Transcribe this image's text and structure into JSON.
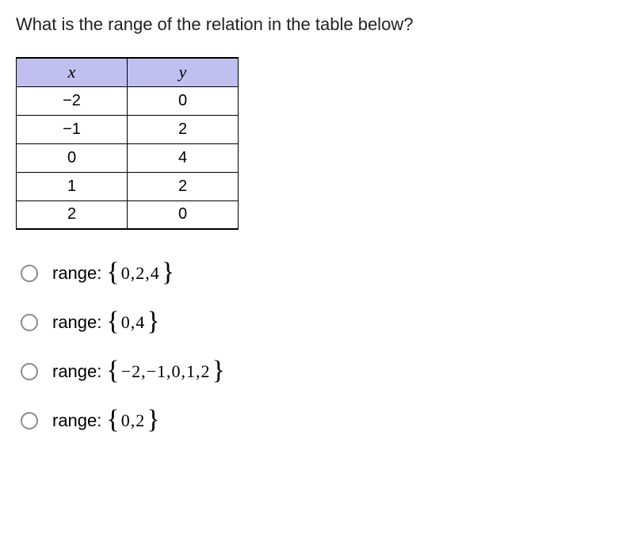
{
  "question": "What is the range of the relation in the table below?",
  "table": {
    "headers": {
      "x": "x",
      "y": "y"
    },
    "rows": [
      {
        "x": "−2",
        "y": "0"
      },
      {
        "x": "−1",
        "y": "2"
      },
      {
        "x": "0",
        "y": "4"
      },
      {
        "x": "1",
        "y": "2"
      },
      {
        "x": "2",
        "y": "0"
      }
    ]
  },
  "options": [
    {
      "label": "range:",
      "set": "0,2,4"
    },
    {
      "label": "range:",
      "set": "0,4"
    },
    {
      "label": "range:",
      "set": "−2,−1,0,1,2"
    },
    {
      "label": "range:",
      "set": "0,2"
    }
  ],
  "braces": {
    "open": "{",
    "close": "}"
  },
  "chart_data": {
    "type": "table",
    "columns": [
      "x",
      "y"
    ],
    "rows": [
      [
        -2,
        0
      ],
      [
        -1,
        2
      ],
      [
        0,
        4
      ],
      [
        1,
        2
      ],
      [
        2,
        0
      ]
    ]
  }
}
